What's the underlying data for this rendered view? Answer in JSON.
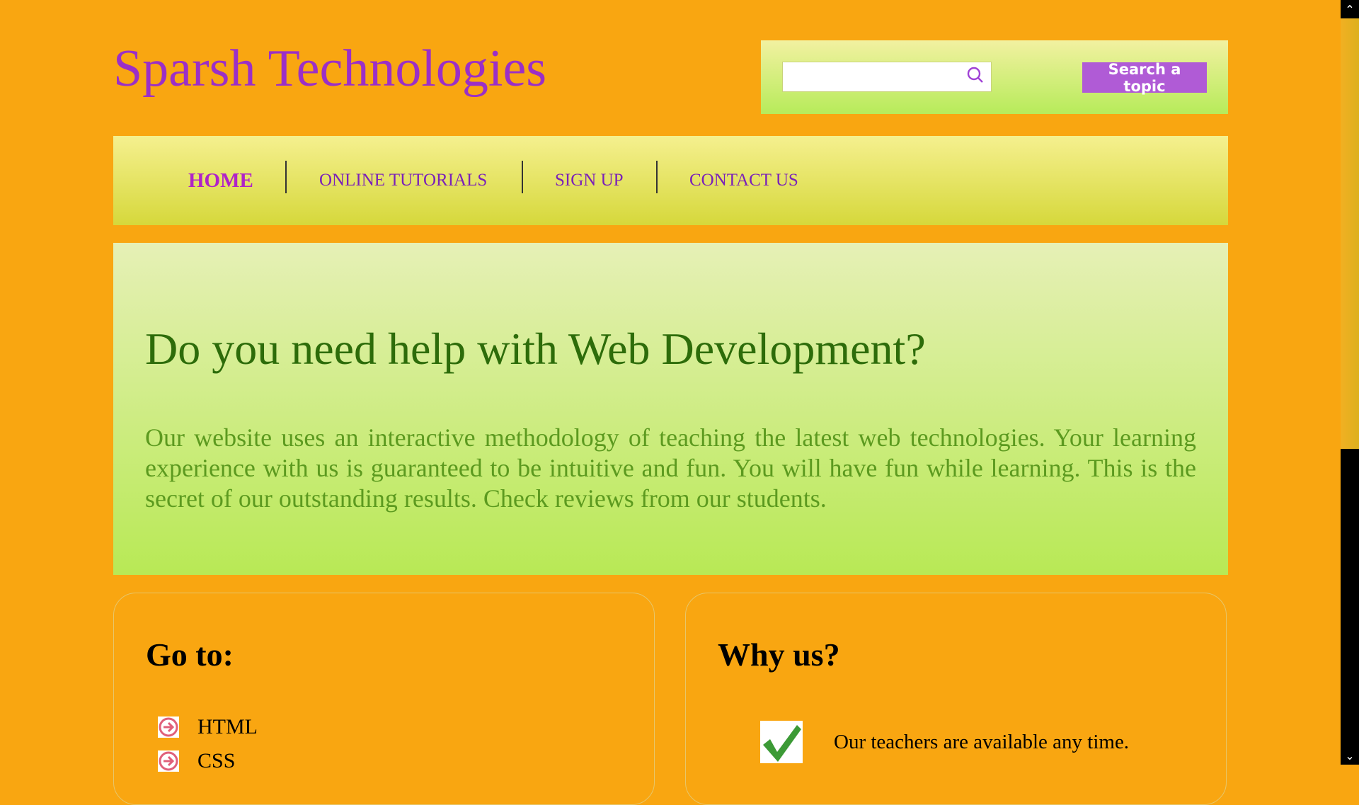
{
  "header": {
    "brand": "Sparsh Technologies",
    "search": {
      "value": "",
      "placeholder": "",
      "button_label": "Search a topic"
    }
  },
  "nav": {
    "items": [
      {
        "label": "HOME",
        "active": true
      },
      {
        "label": "ONLINE TUTORIALS",
        "active": false
      },
      {
        "label": "SIGN UP",
        "active": false
      },
      {
        "label": "CONTACT US",
        "active": false
      }
    ]
  },
  "hero": {
    "title": "Do you need help with Web Development?",
    "text": "Our website uses an interactive methodology of teaching the latest web technologies. Your learning experience with us is guaranteed to be intuitive and fun. You will have fun while learning. This is the secret of our outstanding results. Check reviews from our students."
  },
  "goto": {
    "title": "Go to:",
    "items": [
      "HTML",
      "CSS"
    ]
  },
  "why": {
    "title": "Why us?",
    "items": [
      "Our teachers are available any time."
    ]
  },
  "colors": {
    "background": "#f9a611",
    "brand": "#9b2fc7",
    "hero_title": "#2d6c0a",
    "hero_text": "#5c9a1f",
    "button": "#b05bd6"
  },
  "icons": {
    "search": "search-icon",
    "link_bullet": "arrow-right-circle-icon",
    "check": "checkmark-icon"
  }
}
